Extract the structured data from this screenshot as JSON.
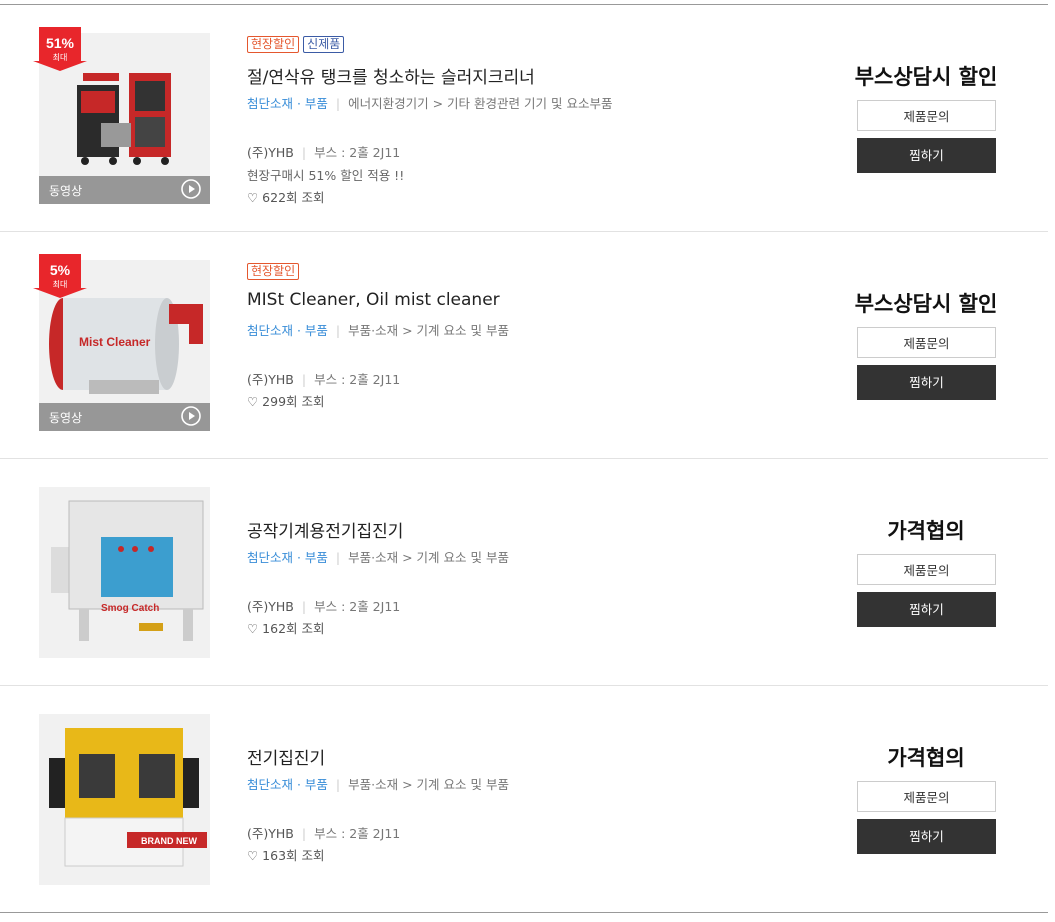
{
  "items": [
    {
      "badges": [
        "현장할인",
        "신제품"
      ],
      "title": "절/연삭유 탱크를 청소하는 슬러지크리너",
      "category_main": "첨단소재 · 부품",
      "category_sub": "에너지환경기기 > 기타 환경관련 기기 및 요소부품",
      "company": "(주)YHB",
      "booth": "부스 : 2홀 2J11",
      "promo": "현장구매시 51% 할인 적용 !!",
      "views": "♡ 622회 조회",
      "price": "부스상담시 할인",
      "discount_pct": "51%",
      "discount_max": "최대",
      "video_label": "동영상",
      "inquiry_label": "제품문의",
      "wish_label": "찜하기"
    },
    {
      "badges": [
        "현장할인"
      ],
      "title": "MISt Cleaner, Oil mist cleaner",
      "category_main": "첨단소재 · 부품",
      "category_sub": "부품·소재 > 기계 요소 및 부품",
      "company": "(주)YHB",
      "booth": "부스 : 2홀 2J11",
      "views": "♡ 299회 조회",
      "price": "부스상담시 할인",
      "discount_pct": "5%",
      "discount_max": "최대",
      "video_label": "동영상",
      "inquiry_label": "제품문의",
      "wish_label": "찜하기",
      "image_text": "Mist Cleaner"
    },
    {
      "title": "공작기계용전기집진기",
      "category_main": "첨단소재 · 부품",
      "category_sub": "부품·소재 > 기계 요소 및 부품",
      "company": "(주)YHB",
      "booth": "부스 : 2홀 2J11",
      "views": "♡ 162회 조회",
      "price": "가격협의",
      "inquiry_label": "제품문의",
      "wish_label": "찜하기",
      "image_text": "Smog Catch"
    },
    {
      "title": "전기집진기",
      "category_main": "첨단소재 · 부품",
      "category_sub": "부품·소재 > 기계 요소 및 부품",
      "company": "(주)YHB",
      "booth": "부스 : 2홀 2J11",
      "views": "♡ 163회 조회",
      "price": "가격협의",
      "inquiry_label": "제품문의",
      "wish_label": "찜하기",
      "image_text": "BRAND NEW"
    }
  ],
  "colors": {
    "sale": "#e4572e",
    "new": "#3b5ba5",
    "category": "#3a8ed8",
    "ribbon": "#e8262b",
    "wish_bg": "#333333"
  },
  "icons": {
    "play": "play-circle-icon",
    "ribbon": "discount-ribbon-icon",
    "heart": "heart-icon"
  }
}
